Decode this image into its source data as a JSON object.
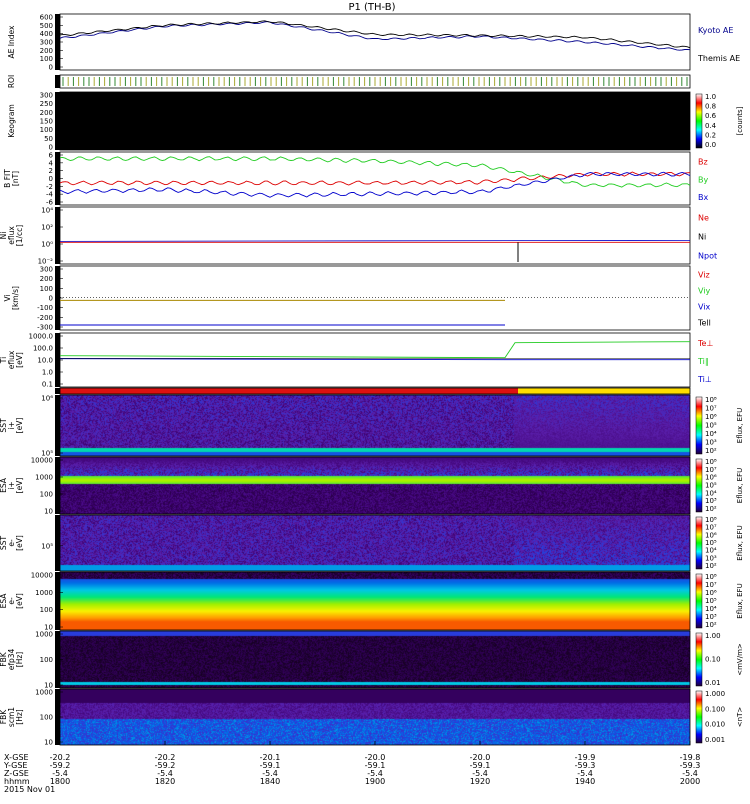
{
  "title": "P1 (TH-B)",
  "colors": {
    "kyoto": "#00008b",
    "themis": "#000000",
    "red": "#dd0000",
    "green": "#22cc22",
    "blue": "#0000cc",
    "black": "#000000"
  },
  "panels": [
    {
      "id": "ae",
      "ylabel": [
        "AE Index"
      ],
      "ticks": [
        "600",
        "500",
        "400",
        "300",
        "200",
        "100",
        "0"
      ],
      "legend": [
        {
          "text": "Kyoto AE",
          "color": "#00008b"
        },
        {
          "text": "Themis AE",
          "color": "#000000"
        }
      ]
    },
    {
      "id": "roi",
      "ylabel": [
        "ROI"
      ],
      "ticks": [],
      "legend": []
    },
    {
      "id": "keogram",
      "ylabel": [
        "Keogram"
      ],
      "ticks": [
        "300",
        "250",
        "200",
        "150",
        "100",
        "50",
        "0"
      ],
      "legend": [],
      "colorbar": {
        "ticks": [
          "1.0",
          "0.8",
          "0.6",
          "0.4",
          "0.2",
          "0.0"
        ],
        "label": "[counts]",
        "stops": [
          "#ffffff",
          "#ff0000",
          "#ffff00",
          "#00ff00",
          "#00ffff",
          "#0000ff",
          "#000000"
        ]
      }
    },
    {
      "id": "bfield",
      "ylabel": [
        "B FIT",
        "[nT]"
      ],
      "ticks": [
        "6",
        "4",
        "2",
        "0",
        "-2",
        "-4",
        "-6"
      ],
      "legend": [
        {
          "text": "Bz",
          "color": "#dd0000"
        },
        {
          "text": "By",
          "color": "#22cc22"
        },
        {
          "text": "Bx",
          "color": "#0000cc"
        }
      ]
    },
    {
      "id": "density",
      "ylabel": [
        "Ni",
        "eflux",
        "[1/cc]"
      ],
      "ticks": [
        "10⁴",
        "10²",
        "10⁰",
        "10⁻²"
      ],
      "legend": [
        {
          "text": "Ne",
          "color": "#dd0000"
        },
        {
          "text": "Ni",
          "color": "#000000"
        },
        {
          "text": "Npot",
          "color": "#0000cc"
        }
      ]
    },
    {
      "id": "velocity",
      "ylabel": [
        "Vi",
        "[km/s]"
      ],
      "ticks": [
        "300",
        "200",
        "100",
        "0",
        "-100",
        "-200",
        "-300"
      ],
      "legend": [
        {
          "text": "Viz",
          "color": "#dd0000"
        },
        {
          "text": "Viy",
          "color": "#22cc22"
        },
        {
          "text": "Vix",
          "color": "#0000cc"
        },
        {
          "text": "Tell",
          "color": "#000000"
        }
      ]
    },
    {
      "id": "temp",
      "ylabel": [
        "Ti",
        "eflux",
        "[eV]"
      ],
      "ticks": [
        "1000.0",
        "100.0",
        "10.0",
        "1.0",
        "0.1"
      ],
      "legend": [
        {
          "text": "Te⊥",
          "color": "#dd0000"
        },
        {
          "text": "Ti∥",
          "color": "#22cc22"
        },
        {
          "text": "Ti⊥",
          "color": "#0000cc"
        }
      ]
    },
    {
      "id": "mode",
      "ylabel": [],
      "ticks": [],
      "legend": []
    },
    {
      "id": "sst_i",
      "ylabel": [
        "SST",
        "i+",
        "[eV]"
      ],
      "ticks": [
        "10⁶",
        "10⁵"
      ],
      "legend": [],
      "colorbar": {
        "ticks": [
          "10⁸",
          "10⁷",
          "10⁶",
          "10⁵",
          "10⁴",
          "10³",
          "10²"
        ],
        "label": "Eflux, EFU",
        "stops": [
          "#ffffff",
          "#ff0000",
          "#ffff00",
          "#00ff00",
          "#00ffff",
          "#0000ff",
          "#220033"
        ]
      }
    },
    {
      "id": "esa_i",
      "ylabel": [
        "ESA",
        "i+",
        "[eV]"
      ],
      "ticks": [
        "10000",
        "1000",
        "100",
        "10"
      ],
      "legend": [],
      "colorbar": {
        "ticks": [
          "10⁸",
          "10⁷",
          "10⁶",
          "10⁵",
          "10⁴",
          "10³",
          "10²"
        ],
        "label": "Eflux, EFU",
        "stops": [
          "#ffffff",
          "#ff0000",
          "#ffff00",
          "#00ff00",
          "#00ffff",
          "#0000ff",
          "#220033"
        ]
      }
    },
    {
      "id": "sst_e",
      "ylabel": [
        "SST",
        "e-",
        "[eV]"
      ],
      "ticks": [
        "10⁵"
      ],
      "legend": [],
      "colorbar": {
        "ticks": [
          "10⁸",
          "10⁷",
          "10⁶",
          "10⁵",
          "10⁴",
          "10³",
          "10²"
        ],
        "label": "Eflux, EFU",
        "stops": [
          "#ffffff",
          "#ff0000",
          "#ffff00",
          "#00ff00",
          "#00ffff",
          "#0000ff",
          "#220033"
        ]
      }
    },
    {
      "id": "esa_e",
      "ylabel": [
        "ESA",
        "e-",
        "[eV]"
      ],
      "ticks": [
        "10000",
        "1000",
        "100",
        "10"
      ],
      "legend": [],
      "colorbar": {
        "ticks": [
          "10⁸",
          "10⁷",
          "10⁶",
          "10⁵",
          "10⁴",
          "10³",
          "10²"
        ],
        "label": "Eflux, EFU",
        "stops": [
          "#ffffff",
          "#ff0000",
          "#ffff00",
          "#00ff00",
          "#00ffff",
          "#0000ff",
          "#220033"
        ]
      }
    },
    {
      "id": "fbk_e",
      "ylabel": [
        "FBK",
        "efp34",
        "[Hz]"
      ],
      "ticks": [
        "1000",
        "100",
        "10"
      ],
      "legend": [],
      "colorbar": {
        "ticks": [
          "1.00",
          "0.10",
          "0.01"
        ],
        "label": "<mV/m>",
        "stops": [
          "#ffffff",
          "#ff0000",
          "#ffff00",
          "#00ff00",
          "#00ffff",
          "#0000ff",
          "#220033"
        ]
      }
    },
    {
      "id": "fbk_b",
      "ylabel": [
        "FBK",
        "scm1",
        "[Hz]"
      ],
      "ticks": [
        "1000",
        "100",
        "10"
      ],
      "legend": [],
      "colorbar": {
        "ticks": [
          "1.000",
          "0.100",
          "0.010",
          "0.001"
        ],
        "label": "<nT>",
        "stops": [
          "#ffffff",
          "#ff0000",
          "#ffff00",
          "#00ff00",
          "#00ffff",
          "#0000ff",
          "#220033"
        ]
      }
    }
  ],
  "footer": {
    "row_labels": [
      "X-GSE",
      "Y-GSE",
      "Z-GSE",
      "hhmm",
      "2015 Nov 01"
    ],
    "columns": [
      {
        "x": "-20.2",
        "y": "-59.2",
        "z": "-5.4",
        "t": "1800"
      },
      {
        "x": "-20.2",
        "y": "-59.2",
        "z": "-5.4",
        "t": "1820"
      },
      {
        "x": "-20.1",
        "y": "-59.1",
        "z": "-5.4",
        "t": "1840"
      },
      {
        "x": "-20.0",
        "y": "-59.1",
        "z": "-5.4",
        "t": "1900"
      },
      {
        "x": "-20.0",
        "y": "-59.1",
        "z": "-5.4",
        "t": "1920"
      },
      {
        "x": "-19.9",
        "y": "-59.3",
        "z": "-5.4",
        "t": "1940"
      },
      {
        "x": "-19.8",
        "y": "-59.3",
        "z": "-5.4",
        "t": "2000"
      }
    ]
  },
  "chart_data": [
    {
      "type": "line",
      "panel": "ae",
      "x": [
        "1800",
        "1820",
        "1840",
        "1900",
        "1920",
        "1940",
        "2000"
      ],
      "ylim": [
        0,
        600
      ],
      "series": [
        {
          "name": "Kyoto AE",
          "values": [
            340,
            470,
            510,
            330,
            360,
            300,
            210
          ]
        },
        {
          "name": "Themis AE",
          "values": [
            370,
            480,
            520,
            380,
            370,
            350,
            240
          ]
        }
      ]
    },
    {
      "type": "line",
      "panel": "bfield",
      "x": [
        "1800",
        "1820",
        "1840",
        "1900",
        "1920",
        "1940",
        "2000"
      ],
      "ylim": [
        -6,
        6
      ],
      "series": [
        {
          "name": "Bz",
          "values": [
            -1,
            -1,
            -1,
            -1,
            -0.8,
            1,
            1
          ]
        },
        {
          "name": "By",
          "values": [
            4.5,
            4.5,
            4.5,
            4,
            3,
            -1.5,
            -1.5
          ]
        },
        {
          "name": "Bx",
          "values": [
            -3,
            -2.5,
            -3.8,
            -3.5,
            -3,
            1,
            1
          ]
        }
      ]
    },
    {
      "type": "heatmap",
      "panel": "sst_i",
      "x": [
        "1800",
        "1820",
        "1840",
        "1900",
        "1920",
        "1940",
        "2000"
      ]
    },
    {
      "type": "heatmap",
      "panel": "esa_i",
      "x": [
        "1800",
        "1820",
        "1840",
        "1900",
        "1920",
        "1940",
        "2000"
      ]
    },
    {
      "type": "heatmap",
      "panel": "sst_e",
      "x": [
        "1800",
        "1820",
        "1840",
        "1900",
        "1920",
        "1940",
        "2000"
      ]
    },
    {
      "type": "heatmap",
      "panel": "esa_e",
      "x": [
        "1800",
        "1820",
        "1840",
        "1900",
        "1920",
        "1940",
        "2000"
      ]
    },
    {
      "type": "heatmap",
      "panel": "fbk_e",
      "x": [
        "1800",
        "1820",
        "1840",
        "1900",
        "1920",
        "1940",
        "2000"
      ]
    },
    {
      "type": "heatmap",
      "panel": "fbk_b",
      "x": [
        "1800",
        "1820",
        "1840",
        "1900",
        "1920",
        "1940",
        "2000"
      ]
    }
  ]
}
